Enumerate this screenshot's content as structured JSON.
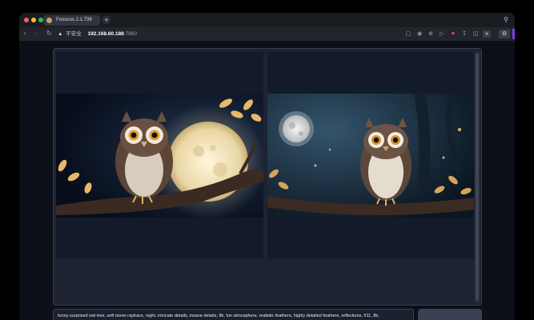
{
  "browser": {
    "tab_title": "Fooocus 2.1.739",
    "new_tab_symbol": "+",
    "security_warning": "不安全",
    "url_host": "192.168.60.188",
    "url_port": ":7860",
    "colors": {
      "close": "#ff5f57",
      "minimize": "#febc2e",
      "maximize": "#28c840",
      "accent": "#7c3aed"
    }
  },
  "toolbar_icons": [
    "open-in-icon",
    "camera-icon",
    "translate-icon",
    "play-icon",
    "heart-icon",
    "download-icon",
    "sidebar-icon",
    "profile-icon"
  ],
  "gallery": {
    "images": [
      {
        "subject": "owl-on-branch-full-moon"
      },
      {
        "subject": "owl-on-branch-night-forest"
      }
    ]
  },
  "prompt": {
    "value": "funny surprised owl tree, soft moon raytrace, night, intricate details, insane details, 8k, fun atmosphere, realistic feathers, highly detailed feathers, reflections,  f/11, 8k,"
  }
}
